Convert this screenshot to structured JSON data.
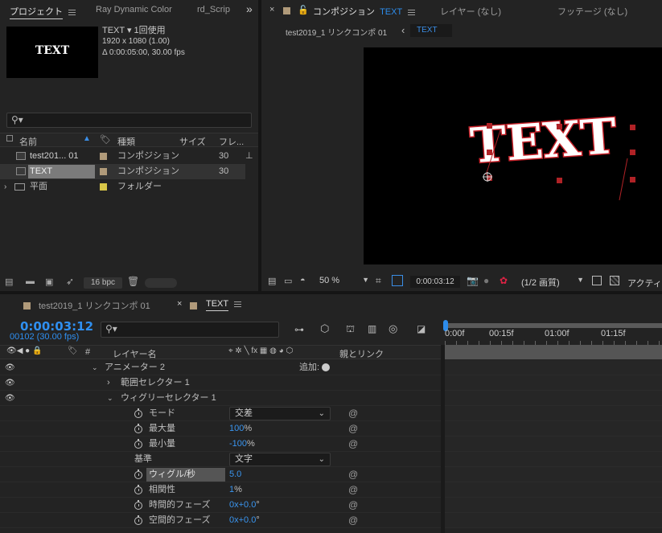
{
  "project_panel": {
    "tabs": [
      {
        "label": "プロジェクト",
        "active": true
      },
      {
        "label": "Ray Dynamic Color"
      },
      {
        "label": "rd_Scrip"
      }
    ],
    "more": "»",
    "thumbnail_text": "TEXT",
    "info_name": "TEXT ▾ 1回使用",
    "info_size": "1920 x 1080 (1.00)",
    "info_duration": "Δ 0:00:05:00, 30.00 fps",
    "search_placeholder": "",
    "columns": {
      "name": "名前",
      "type": "種類",
      "size": "サイズ",
      "frame": "フレ..."
    },
    "items": [
      {
        "name": "test201... 01",
        "type": "コンポジション",
        "frame": "30",
        "color": "#b09a7a"
      },
      {
        "name": "TEXT",
        "type": "コンポジション",
        "frame": "30",
        "color": "#b09a7a"
      },
      {
        "name": "平面",
        "type": "フォルダー",
        "frame": "",
        "color": "#d8c648"
      }
    ],
    "bpc": "16 bpc"
  },
  "comp_panel": {
    "tab_close": "×",
    "tab_lock": "🔒",
    "tab_label": "コンポジション",
    "tab_comp": "TEXT",
    "layer_tab": "レイヤー (なし)",
    "footage_tab": "フッテージ (なし)",
    "breadcrumb_parent": "test2019_1 リンクコンポ 01",
    "breadcrumb_back": "‹",
    "breadcrumb_current": "TEXT",
    "canvas_text": "TEXT",
    "zoom": "50 %",
    "timecode": "0:00:03:12",
    "resolution": "(1/2 画質)",
    "active_camera": "アクティ"
  },
  "timeline_panel": {
    "tabs": [
      {
        "label": "test2019_1 リンクコンポ 01"
      },
      {
        "label": "TEXT",
        "active": true
      }
    ],
    "timecode": "0:00:03:12",
    "frame_info": "00102 (30.00 fps)",
    "search_placeholder": "",
    "col_hash": "#",
    "col_layer_name": "レイヤー名",
    "col_parent": "親とリンク",
    "ruler_labels": [
      "0:00f",
      "00:15f",
      "01:00f",
      "01:15f"
    ],
    "rows": [
      {
        "indent": 1,
        "twirl": "open",
        "label": "アニメーター 2",
        "extra": "追加:"
      },
      {
        "indent": 2,
        "twirl": "closed",
        "label": "範囲セレクター 1"
      },
      {
        "indent": 2,
        "twirl": "open",
        "label": "ウィグリーセレクター 1"
      },
      {
        "indent": 3,
        "stopwatch": true,
        "label": "モード",
        "dropdown": "交差"
      },
      {
        "indent": 3,
        "stopwatch": true,
        "label": "最大量",
        "value": "100",
        "unit": "%"
      },
      {
        "indent": 3,
        "stopwatch": true,
        "label": "最小量",
        "value": "-100",
        "unit": "%"
      },
      {
        "indent": 3,
        "stopwatch": false,
        "label": "基準",
        "dropdown": "文字"
      },
      {
        "indent": 3,
        "stopwatch": true,
        "label": "ウィグル/秒",
        "value": "5.0",
        "highlight": true
      },
      {
        "indent": 3,
        "stopwatch": true,
        "label": "相関性",
        "value": "1",
        "unit": "%"
      },
      {
        "indent": 3,
        "stopwatch": true,
        "label": "時間的フェーズ",
        "value": "0x+0.0",
        "unit": "°"
      },
      {
        "indent": 3,
        "stopwatch": true,
        "label": "空間的フェーズ",
        "value": "0x+0.0",
        "unit": "°"
      }
    ]
  }
}
